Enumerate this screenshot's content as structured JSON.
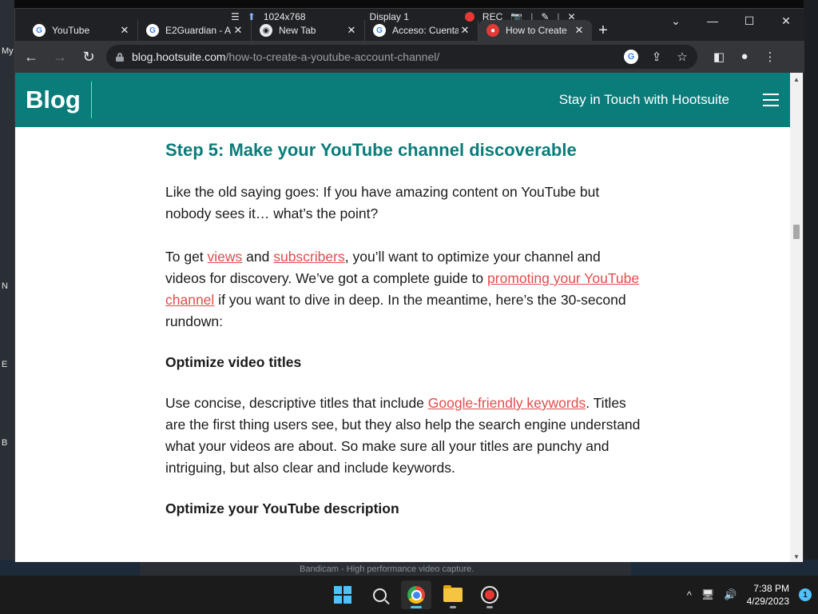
{
  "desktop": {
    "left_glyphs": [
      "My",
      "N",
      "E",
      "B"
    ],
    "background_app_text": "Bandicam - High performance video capture."
  },
  "recorder_bar": {
    "resolution": "1024x768",
    "display": "Display 1",
    "rec_label": "REC"
  },
  "tabs": [
    {
      "label": "YouTube",
      "favicon": "google-icon"
    },
    {
      "label": "E2Guardian - A",
      "favicon": "google-icon"
    },
    {
      "label": "New Tab",
      "favicon": "chrome-icon"
    },
    {
      "label": "Acceso: Cuenta",
      "favicon": "google-icon"
    },
    {
      "label": "How to Create",
      "favicon": "hootsuite-owl-icon",
      "active": true
    }
  ],
  "address_bar": {
    "host": "blog.hootsuite.com",
    "path": "/how-to-create-a-youtube-account-channel/"
  },
  "site": {
    "logo": "Blog",
    "nav_link": "Stay in Touch with Hootsuite",
    "brand_color": "#0a7c7a",
    "link_color": "#e34c4c"
  },
  "article": {
    "heading": "Step 5: Make your YouTube channel discoverable",
    "p1": "Like the old saying goes: If you have amazing content on YouTube but nobody sees it… what’s the point?",
    "p2_a": "To get ",
    "p2_link1": "views",
    "p2_b": " and ",
    "p2_link2": "subscribers",
    "p2_c": ", you’ll want to optimize your channel and videos for discovery. We’ve got a complete guide to ",
    "p2_link3": "promoting your YouTube channel",
    "p2_d": " if you want to dive in deep. In the meantime, here’s the 30-second rundown:",
    "sub1": "Optimize video titles",
    "p3_a": "Use concise, descriptive titles that include ",
    "p3_link": "Google-friendly keywords",
    "p3_b": ". Titles are the first thing users see, but they also help the search engine understand what your videos are about. So make sure all your titles are punchy and intriguing, but also clear and include keywords.",
    "sub2": "Optimize your YouTube description"
  },
  "taskbar": {
    "time": "7:38 PM",
    "date": "4/29/2023",
    "notification_count": "1"
  }
}
